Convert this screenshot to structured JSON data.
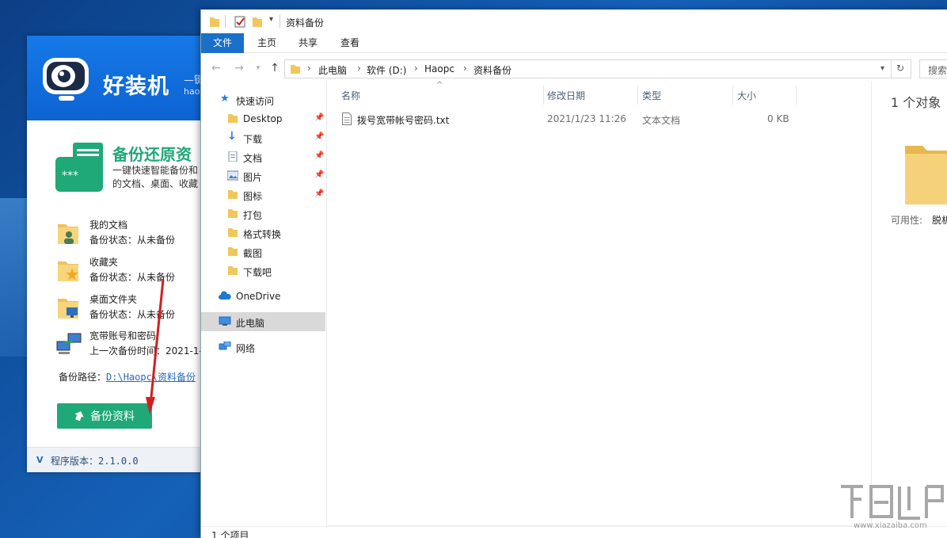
{
  "haozhuangji": {
    "brand": "好装机",
    "slogan": "—键",
    "sub": "hao",
    "feature": {
      "title": "备份还原资",
      "desc_line1": "一键快速智能备份和",
      "desc_line2": "的文档、桌面、收藏"
    },
    "items": [
      {
        "name": "我的文档",
        "status": "备份状态：从未备份"
      },
      {
        "name": "收藏夹",
        "status": "备份状态：从未备份"
      },
      {
        "name": "桌面文件夹",
        "status": "备份状态：从未备份"
      },
      {
        "name": "宽带账号和密码",
        "status": "上一次备份时间：2021-1-"
      }
    ],
    "path_label": "备份路径：",
    "path_value": "D:\\Haopc\\资料备份",
    "backup_button": "备份资料",
    "version": "程序版本：2.1.0.0",
    "version_badge": "V"
  },
  "explorer": {
    "title": "资料备份",
    "ribbon_tabs": [
      "文件",
      "主页",
      "共享",
      "查看"
    ],
    "breadcrumb": [
      "此电脑",
      "软件 (D:)",
      "Haopc",
      "资料备份"
    ],
    "search_placeholder": "搜索",
    "nav": {
      "quick_access": "快速访问",
      "items": [
        "Desktop",
        "下载",
        "文档",
        "图片",
        "图标",
        "打包",
        "格式转换",
        "截图",
        "下载吧"
      ],
      "onedrive": "OneDrive",
      "this_pc": "此电脑",
      "network": "网络"
    },
    "columns": {
      "name": "名称",
      "modified": "修改日期",
      "type": "类型",
      "size": "大小"
    },
    "files": [
      {
        "name": "拨号宽带帐号密码.txt",
        "modified": "2021/1/23 11:26",
        "type": "文本文档",
        "size": "0 KB"
      }
    ],
    "preview": {
      "count": "1 个对象",
      "avail_label": "可用性:",
      "avail_value": "脱机"
    },
    "status": "1 个项目"
  },
  "watermark": {
    "text": "www.xiazaiba.com"
  },
  "colors": {
    "accent_blue": "#1a6fc9",
    "brand_green": "#1fa878",
    "header_blue": "#1679e8"
  }
}
